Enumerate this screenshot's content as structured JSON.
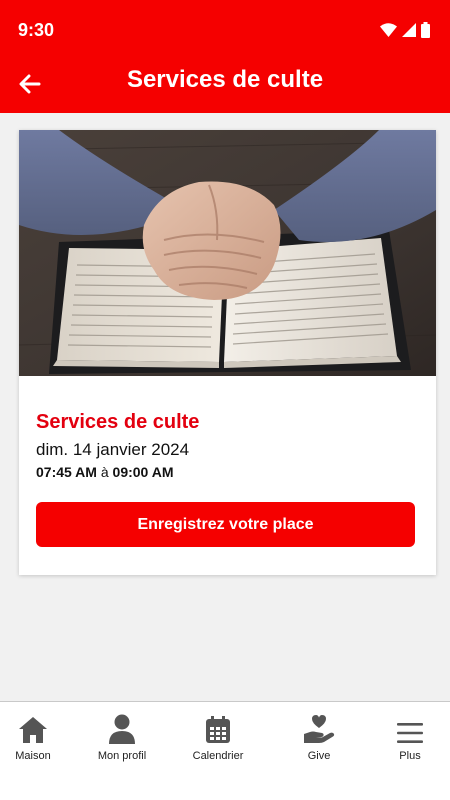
{
  "status_bar": {
    "time": "9:30"
  },
  "header": {
    "title": "Services de culte"
  },
  "card": {
    "title": "Services de culte",
    "date": "dim. 14 janvier 2024",
    "time_start": "07:45 AM",
    "time_separator": "à",
    "time_end": "09:00 AM",
    "button_label": "Enregistrez votre place"
  },
  "bottom_nav": {
    "items": [
      {
        "label": "Maison",
        "icon": "home-icon"
      },
      {
        "label": "Mon profil",
        "icon": "person-icon"
      },
      {
        "label": "Calendrier",
        "icon": "calendar-icon"
      },
      {
        "label": "Give",
        "icon": "give-hand-heart-icon"
      },
      {
        "label": "Plus",
        "icon": "menu-icon"
      }
    ]
  },
  "colors": {
    "brand": "#f50000",
    "title_red": "#e3000f",
    "background": "#f1f1f1",
    "nav_icon": "#555555"
  }
}
